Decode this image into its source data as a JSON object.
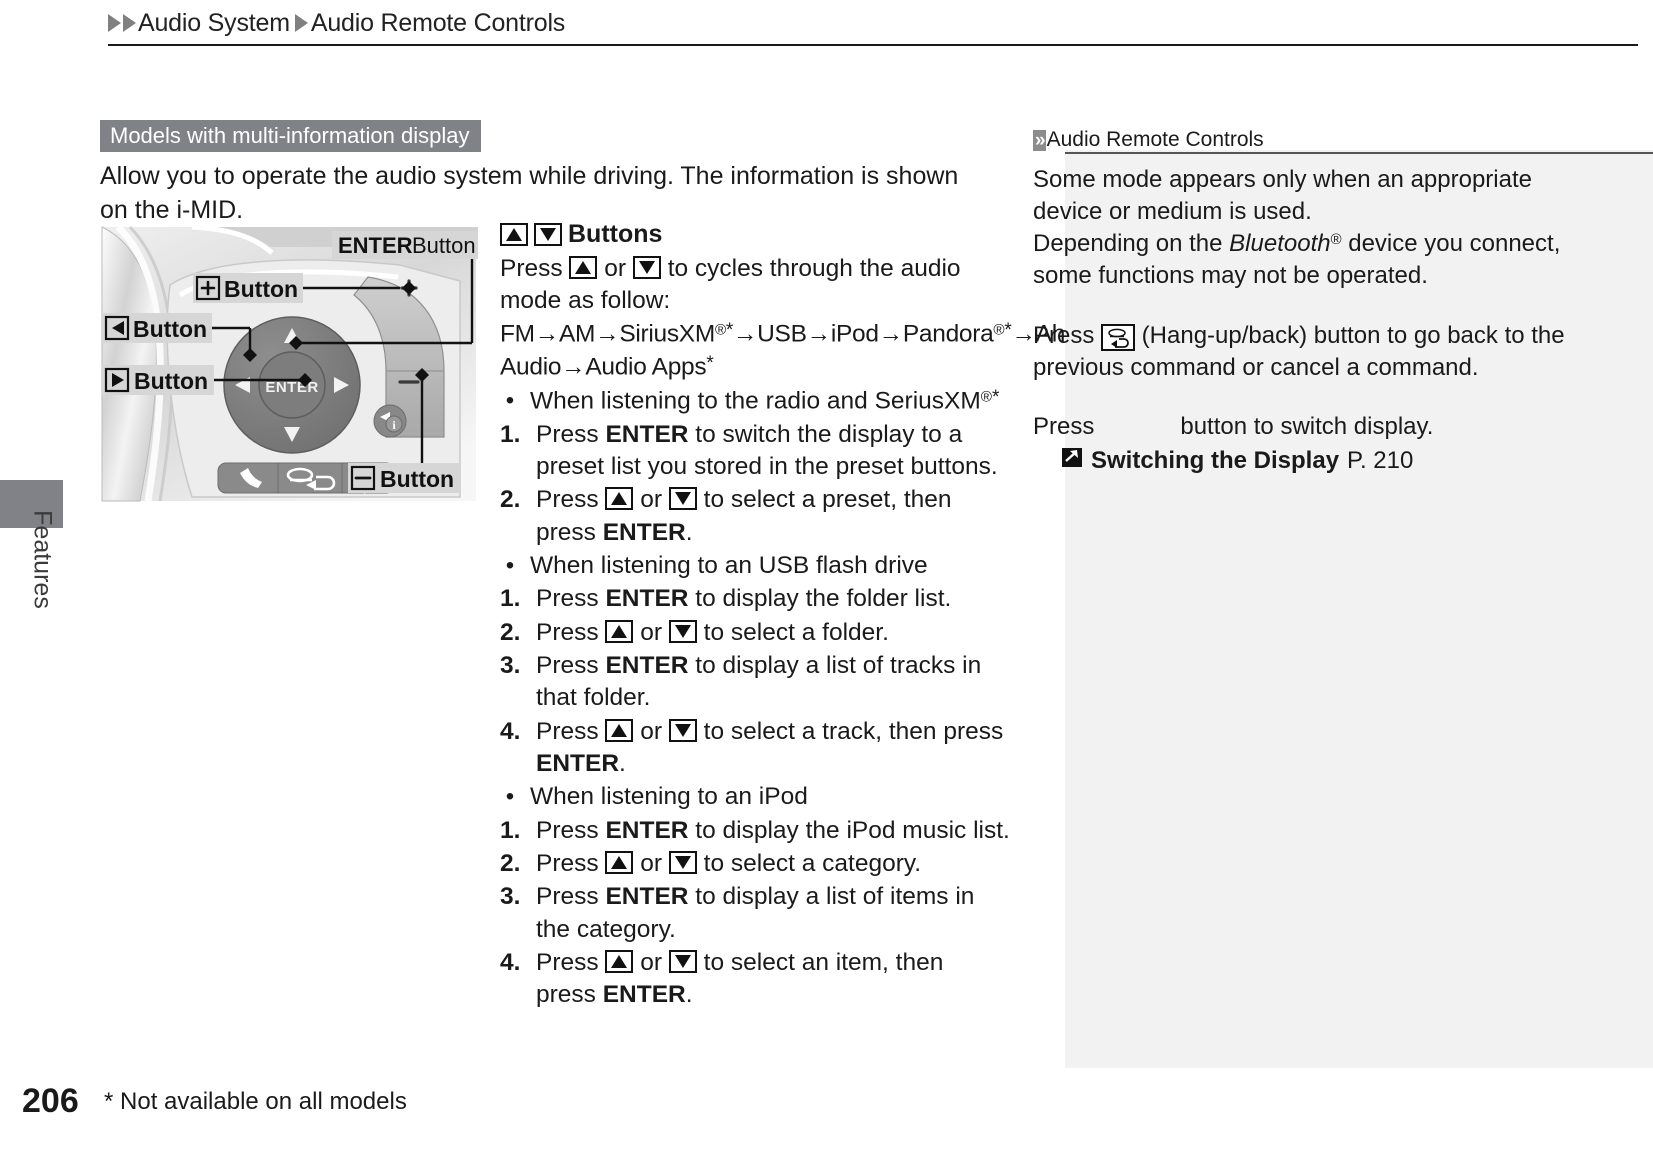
{
  "header": {
    "arrow_icon": "double-right-arrow-icon",
    "crumb1": "Audio System",
    "separator_icon": "right-arrow-icon",
    "crumb2": "Audio Remote Controls"
  },
  "side_tab": {
    "label": "Features"
  },
  "footer": {
    "page_number": "206",
    "footnote": "* Not available on all models"
  },
  "main": {
    "section_chip": "Models with multi-information display",
    "intro": "Allow you to operate the audio system while driving. The information is shown on the i-MID.",
    "illustration": {
      "name": "steering-wheel-audio-remote-controls",
      "callouts": {
        "enter": "ENTER Button",
        "plus": "Button",
        "plus_glyph": "+",
        "left": "Button",
        "left_glyph": "◀",
        "right": "Button",
        "right_glyph": "▶",
        "minus": "Button",
        "minus_glyph": "−",
        "center_label": "ENTER"
      }
    },
    "instructions": {
      "title_suffix": "Buttons",
      "press_lead": "Press",
      "press_or": "or",
      "press_tail": "to cycles through the audio mode as follow:",
      "mode_chain": "FM→AM→SiriusXM®*→USB→iPod→Pandora®*→Aha*→Bluetooth® Audio→Audio Apps*",
      "groups": [
        {
          "bullet": "When listening to the radio and SeriusXM®*",
          "steps": [
            {
              "n": "1.",
              "text_before": "Press ",
              "bold": "ENTER",
              "text_after": " to switch the display to a preset list you stored in the preset buttons."
            },
            {
              "n": "2.",
              "kind": "arrows",
              "lead": "Press ",
              "mid": " or ",
              "tail": " to select a preset, then press ",
              "bold_end": "ENTER",
              "period": "."
            }
          ]
        },
        {
          "bullet": "When listening to an USB flash drive",
          "steps": [
            {
              "n": "1.",
              "text_before": "Press ",
              "bold": "ENTER",
              "text_after": " to display the folder list."
            },
            {
              "n": "2.",
              "kind": "arrows",
              "lead": "Press ",
              "mid": " or ",
              "tail": " to select a folder.",
              "bold_end": "",
              "period": ""
            },
            {
              "n": "3.",
              "text_before": "Press ",
              "bold": "ENTER",
              "text_after": " to display a list of tracks in that folder."
            },
            {
              "n": "4.",
              "kind": "arrows",
              "lead": "Press ",
              "mid": " or ",
              "tail": " to select a track, then press ",
              "bold_end": "ENTER",
              "period": "."
            }
          ]
        },
        {
          "bullet": "When listening to an iPod",
          "steps": [
            {
              "n": "1.",
              "text_before": "Press ",
              "bold": "ENTER",
              "text_after": " to display the iPod music list."
            },
            {
              "n": "2.",
              "kind": "arrows",
              "lead": "Press ",
              "mid": " or ",
              "tail": " to select a category.",
              "bold_end": "",
              "period": ""
            },
            {
              "n": "3.",
              "text_before": "Press ",
              "bold": "ENTER",
              "text_after": " to display a list of items in the category."
            },
            {
              "n": "4.",
              "kind": "arrows",
              "lead": "Press ",
              "mid": " or ",
              "tail": " to select an item, then press ",
              "bold_end": "ENTER",
              "period": "."
            }
          ]
        }
      ]
    }
  },
  "sidebar": {
    "badge_icon": "double-chevron-right-icon",
    "title": "Audio Remote Controls",
    "para1": "Some mode appears only when an appropriate device or medium is used.",
    "para2_before": "Depending on the ",
    "para2_italic": "Bluetooth",
    "para2_sup": "®",
    "para2_after": " device you connect, some functions may not be operated.",
    "para3_lead": "Press ",
    "para3_icon": "hang-up-back-button-icon",
    "para3_tail": " (Hang-up/back) button to go back to the previous command or cancel a command.",
    "para4_lead": "Press",
    "para4_tail": "button to switch display.",
    "reference": {
      "arrow_icon": "goto-reference-arrow-icon",
      "label": "Switching the Display",
      "page": "P. 210"
    }
  },
  "colors": {
    "chip_bg": "#808287",
    "sidebar_bg": "#f2f2f2",
    "badge_bg": "#8c8c8c",
    "text": "#1a1a1a",
    "rule": "#1a1a1a"
  }
}
